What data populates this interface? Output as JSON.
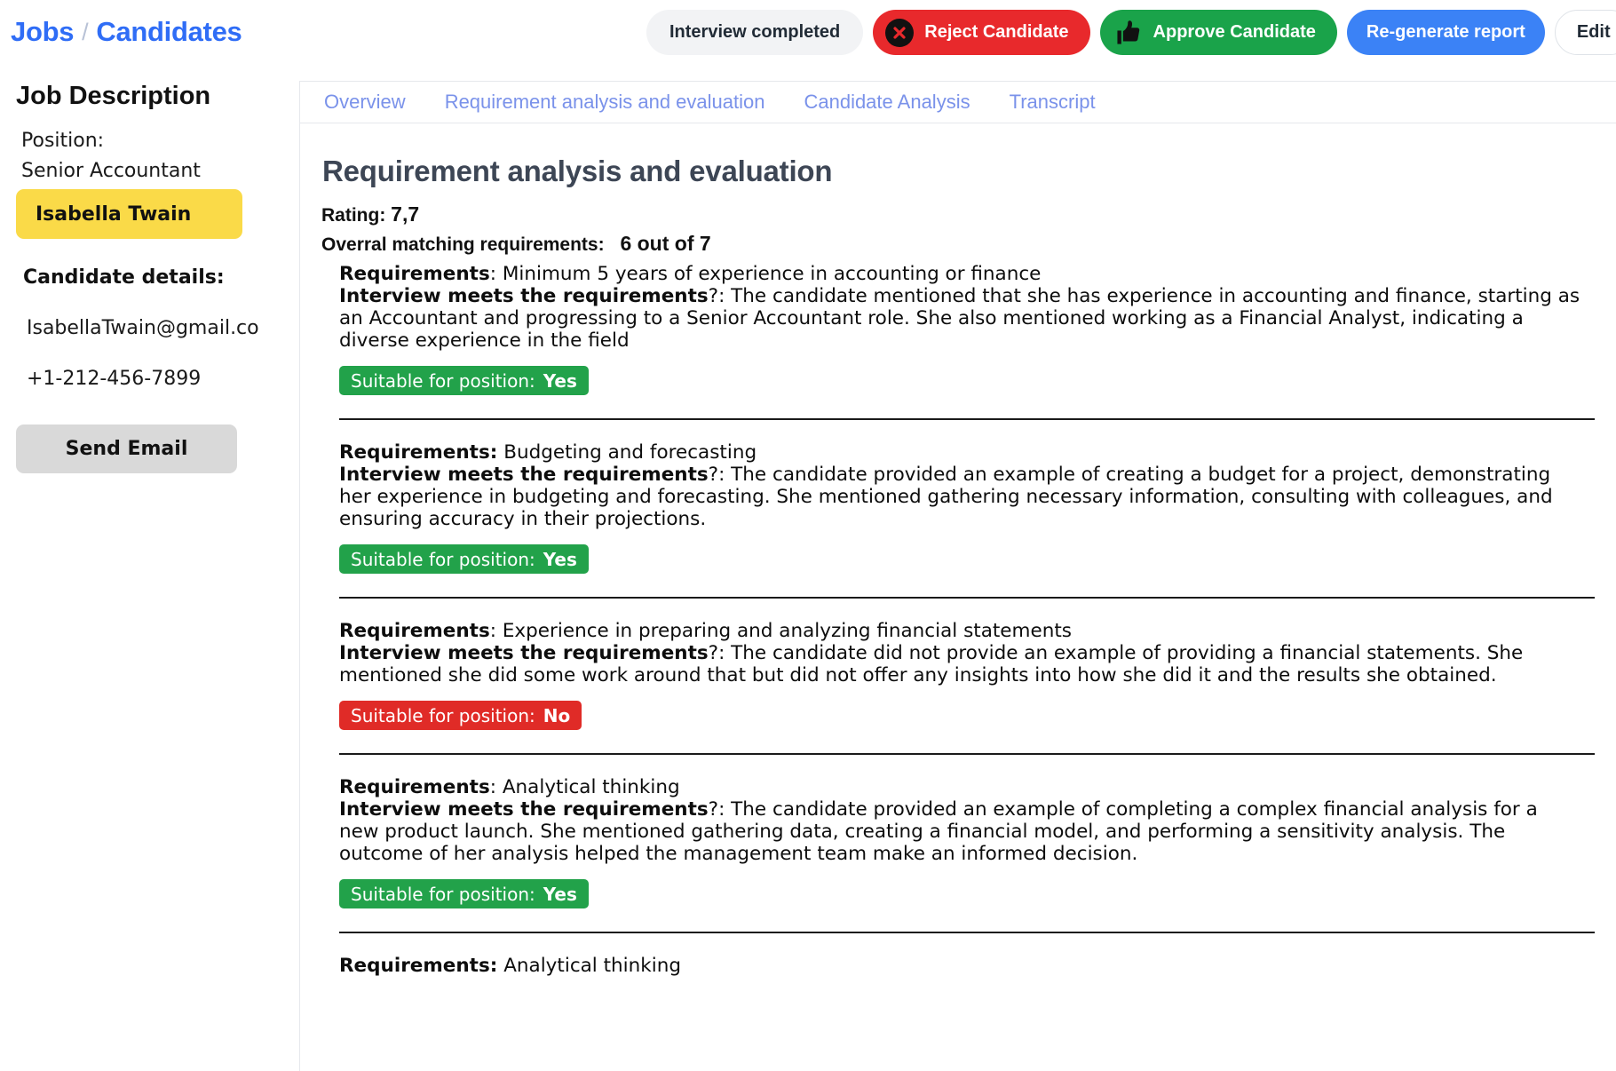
{
  "breadcrumb": {
    "jobs": "Jobs",
    "separator": "/",
    "candidates": "Candidates"
  },
  "actions": {
    "status": "Interview completed",
    "reject": "Reject Candidate",
    "approve": "Approve Candidate",
    "regenerate": "Re-generate report",
    "edit": "Edit"
  },
  "colors": {
    "brand_blue": "#2f6df6",
    "reject_red": "#e8292c",
    "approve_green": "#1aa34a",
    "regen_blue": "#3b82f6",
    "chip_yellow": "#fada48",
    "badge_yes_green": "#22a24a",
    "badge_no_red": "#e02b27",
    "tab_blue": "#7a92ea"
  },
  "sidebar": {
    "title": "Job Description",
    "position_label": "Position:",
    "position_value": "Senior Accountant",
    "candidate_chip": "Isabella Twain",
    "details_heading": "Candidate details:",
    "email": "IsabellaTwain@gmail.co",
    "phone": "+1-212-456-7899",
    "send_email_button": "Send Email"
  },
  "tabs": [
    {
      "label": "Overview",
      "active": false
    },
    {
      "label": "Requirement analysis and evaluation",
      "active": true
    },
    {
      "label": "Candidate Analysis",
      "active": false
    },
    {
      "label": "Transcript",
      "active": false
    }
  ],
  "main": {
    "title": "Requirement analysis and evaluation",
    "rating_label": "Rating",
    "rating_value": "7,7",
    "overall_label": "Overral matching requirements:",
    "overall_value": "6 out of 7",
    "req_label": "Requirements",
    "req_label_colon": "Requirements:",
    "interview_label": "Interview meets the requirements",
    "suitable_label": "Suitable for position:"
  },
  "requirements": [
    {
      "requirement": "Minimum 5 years of experience in accounting or finance",
      "label_style": "outside_colon",
      "evaluation": "The candidate mentioned that she has experience in accounting and finance, starting as an Accountant and progressing to a Senior Accountant role. She also mentioned working as a Financial Analyst, indicating a diverse experience in the field",
      "suitable": "Yes"
    },
    {
      "requirement": "Budgeting and forecasting",
      "label_style": "inside_colon",
      "evaluation": "The candidate provided an example of creating a budget for a project, demonstrating her experience in budgeting and forecasting. She mentioned gathering necessary information, consulting with colleagues, and ensuring accuracy in their projections.",
      "suitable": "Yes"
    },
    {
      "requirement": "Experience in preparing and analyzing financial statements",
      "label_style": "outside_colon",
      "evaluation": "The candidate did not provide an example of providing a financial statements. She mentioned she did some work around that but did not offer any insights into how she did it and the results she obtained.",
      "suitable": "No"
    },
    {
      "requirement": "Analytical thinking",
      "label_style": "outside_colon",
      "evaluation": "The candidate provided an example of completing a complex financial analysis for a new product launch. She mentioned gathering data, creating a financial model, and performing a sensitivity analysis. The outcome of her analysis helped the management team make an informed decision.",
      "suitable": "Yes"
    },
    {
      "requirement": "Analytical thinking",
      "label_style": "inside_colon",
      "evaluation": "",
      "suitable": ""
    }
  ]
}
